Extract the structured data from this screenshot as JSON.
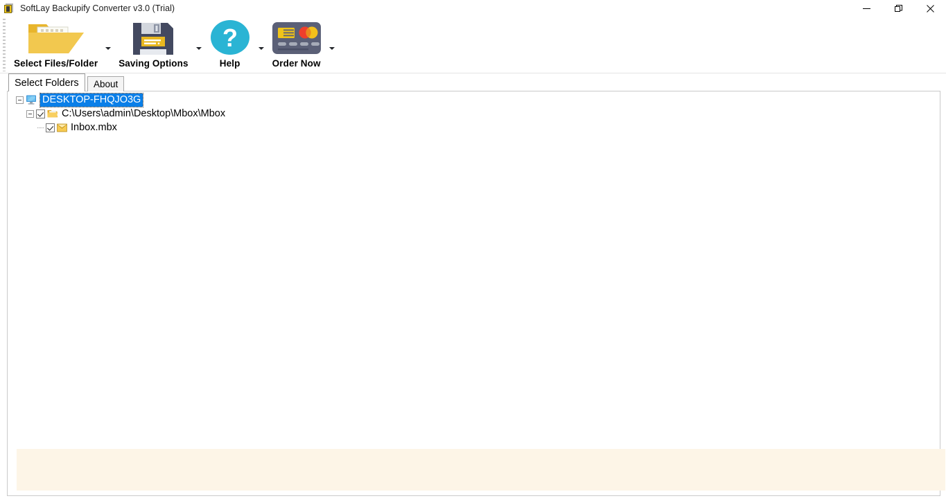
{
  "window": {
    "title": "SoftLay Backupify Converter v3.0 (Trial)",
    "app_icon": "app-logo-icon",
    "controls": {
      "minimize": "minimize-icon",
      "restore": "restore-icon",
      "close": "close-icon"
    }
  },
  "toolbar": {
    "buttons": [
      {
        "label": "Select Files/Folder",
        "icon": "open-folder-icon",
        "has_dropdown": true
      },
      {
        "label": "Saving Options",
        "icon": "floppy-disk-save-icon",
        "has_dropdown": true
      },
      {
        "label": "Help",
        "icon": "question-mark-help-icon",
        "has_dropdown": true
      },
      {
        "label": "Order Now",
        "icon": "credit-card-icon",
        "has_dropdown": true
      }
    ]
  },
  "tabs": [
    {
      "label": "Select Folders",
      "active": true
    },
    {
      "label": "About",
      "active": false
    }
  ],
  "tree": {
    "root": {
      "label": "DESKTOP-FHQJO3G",
      "icon": "computer-monitor-icon",
      "selected": true,
      "expanded": true
    },
    "folder": {
      "label": "C:\\Users\\admin\\Desktop\\Mbox\\Mbox",
      "icon": "folder-open-icon",
      "checked": true,
      "expanded": true
    },
    "file": {
      "label": "Inbox.mbx",
      "icon": "envelope-mail-icon",
      "checked": true
    }
  },
  "colors": {
    "selection_blue": "#0a7fe8",
    "folder_yellow": "#f5c44a",
    "help_cyan": "#29b6d8",
    "card_slate": "#5b6077",
    "status_panel_cream": "#fdf5e7"
  }
}
